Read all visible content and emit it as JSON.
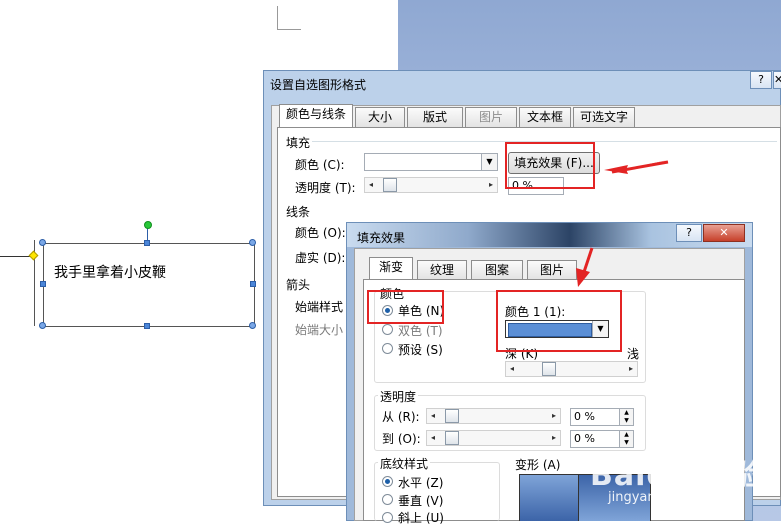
{
  "document": {
    "textbox_text": "我手里拿着小皮鞭"
  },
  "format_dialog": {
    "title": "设置自选图形格式",
    "help": "?",
    "close": "✕",
    "tabs": [
      "颜色与线条",
      "大小",
      "版式",
      "图片",
      "文本框",
      "可选文字"
    ],
    "fill_section": "填充",
    "color_label": "颜色 (C):",
    "fill_effect_button": "填充效果 (F)...",
    "transparency_label": "透明度 (T):",
    "transparency_value": "0 %",
    "line_section": "线条",
    "line_color_label": "颜色 (O):",
    "dash_label": "虚实 (D):",
    "arrow_section": "箭头",
    "begin_style_label": "始端样式 (",
    "begin_size_label": "始端大小 ("
  },
  "fill_effects_dialog": {
    "title": "填充效果",
    "help": "?",
    "close": "✕",
    "tabs": [
      "渐变",
      "纹理",
      "图案",
      "图片"
    ],
    "colors_group": "颜色",
    "color_options": [
      "单色 (N)",
      "双色 (T)",
      "预设 (S)"
    ],
    "selected_color_option": "单色 (N)",
    "color1_label": "颜色 1 (1):",
    "dark_label": "深 (K)",
    "light_label": "浅",
    "color1_value": "#5b8fd6",
    "transparency_group": "透明度",
    "from_label": "从 (R):",
    "to_label": "到 (O):",
    "from_value": "0 %",
    "to_value": "0 %",
    "shading_group": "底纹样式",
    "shading_options": [
      "水平 (Z)",
      "垂直 (V)",
      "斜上 (U)"
    ],
    "selected_shading": "水平 (Z)",
    "variants_label": "变形 (A)"
  },
  "watermark": {
    "brand": "Baidu 经验",
    "url": "jingyan.baidu.com"
  },
  "colors": {
    "annotation_red": "#e32424",
    "selection_blue": "#4b86d9"
  }
}
